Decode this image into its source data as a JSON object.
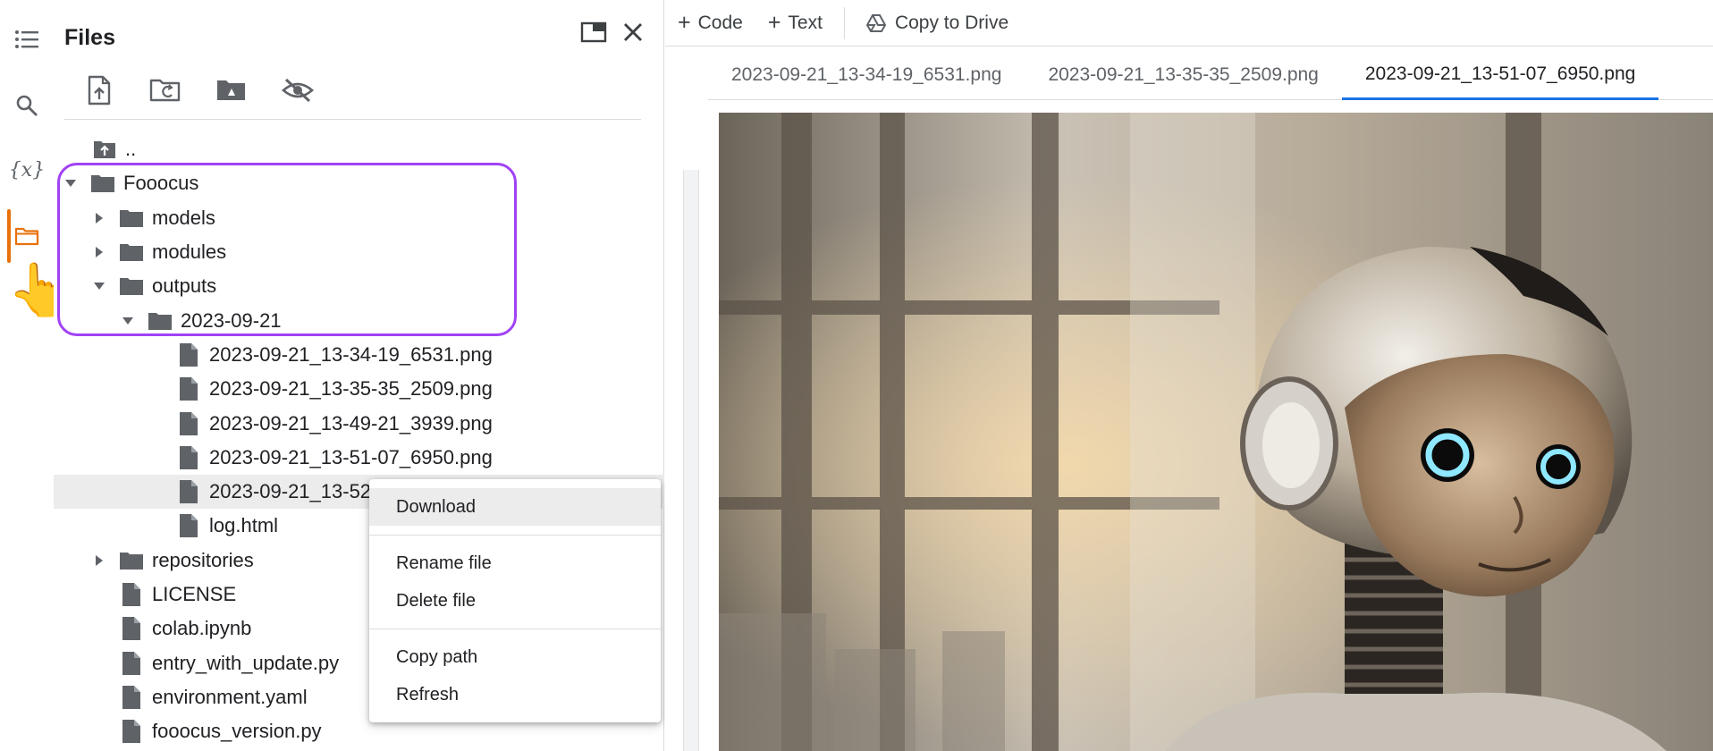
{
  "rail": {
    "items": [
      {
        "name": "table-of-contents",
        "icon": "list-icon"
      },
      {
        "name": "search",
        "icon": "search-icon"
      },
      {
        "name": "variables",
        "icon": "variables-icon",
        "label": "{x}"
      },
      {
        "name": "files",
        "icon": "folder-icon",
        "active": true
      }
    ],
    "accent": "#e8710a"
  },
  "files_panel": {
    "title": "Files",
    "header_icons": [
      "new-window-icon",
      "close-icon"
    ],
    "toolbar": [
      "upload-file-icon",
      "refresh-folder-icon",
      "mount-drive-icon",
      "hide-files-icon"
    ],
    "tree": [
      {
        "label": "..",
        "type": "up",
        "depth": 1
      },
      {
        "label": "Fooocus",
        "type": "folder",
        "depth": 0,
        "expanded": true
      },
      {
        "label": "models",
        "type": "folder",
        "depth": 1,
        "expanded": false
      },
      {
        "label": "modules",
        "type": "folder",
        "depth": 1,
        "expanded": false
      },
      {
        "label": "outputs",
        "type": "folder",
        "depth": 1,
        "expanded": true
      },
      {
        "label": "2023-09-21",
        "type": "folder",
        "depth": 2,
        "expanded": true
      },
      {
        "label": "2023-09-21_13-34-19_6531.png",
        "type": "file",
        "depth": 3
      },
      {
        "label": "2023-09-21_13-35-35_2509.png",
        "type": "file",
        "depth": 3
      },
      {
        "label": "2023-09-21_13-49-21_3939.png",
        "type": "file",
        "depth": 3
      },
      {
        "label": "2023-09-21_13-51-07_6950.png",
        "type": "file",
        "depth": 3
      },
      {
        "label": "2023-09-21_13-52",
        "type": "file",
        "depth": 3,
        "selected": true
      },
      {
        "label": "log.html",
        "type": "file",
        "depth": 3
      },
      {
        "label": "repositories",
        "type": "folder",
        "depth": 1,
        "expanded": false
      },
      {
        "label": "LICENSE",
        "type": "file",
        "depth": 1
      },
      {
        "label": "colab.ipynb",
        "type": "file",
        "depth": 1
      },
      {
        "label": "entry_with_update.py",
        "type": "file",
        "depth": 1
      },
      {
        "label": "environment.yaml",
        "type": "file",
        "depth": 1
      },
      {
        "label": "fooocus_version.py",
        "type": "file",
        "depth": 1
      }
    ],
    "highlight_color": "#a142f4"
  },
  "context_menu": {
    "groups": [
      [
        "Download"
      ],
      [
        "Rename file",
        "Delete file"
      ],
      [
        "Copy path",
        "Refresh"
      ]
    ],
    "hovered": "Download"
  },
  "topbar": {
    "code_label": "Code",
    "text_label": "Text",
    "drive_label": "Copy to Drive"
  },
  "tabs": {
    "items": [
      "2023-09-21_13-34-19_6531.png",
      "2023-09-21_13-35-35_2509.png",
      "2023-09-21_13-51-07_6950.png"
    ],
    "active_index": 2,
    "accent": "#1a73e8"
  }
}
